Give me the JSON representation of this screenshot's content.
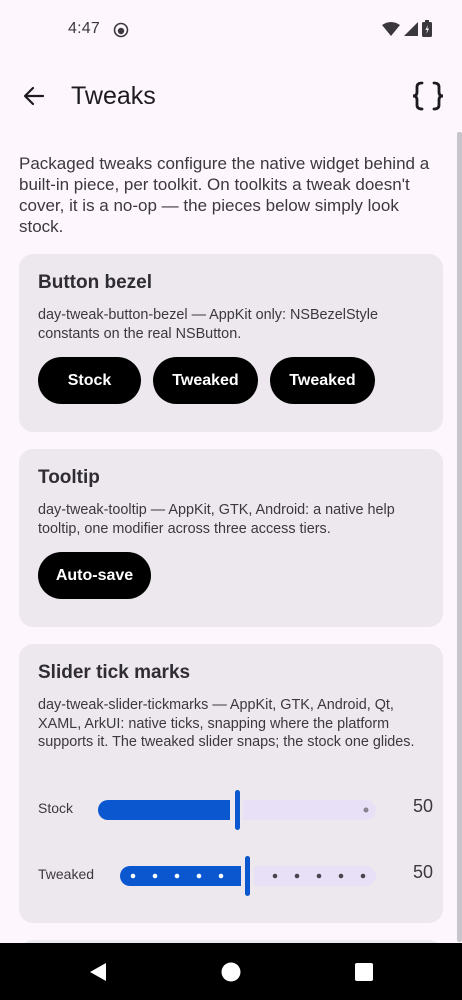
{
  "status_bar": {
    "time": "4:47"
  },
  "app_bar": {
    "title": "Tweaks"
  },
  "intro": "Packaged tweaks configure the native widget behind a built-in piece, per toolkit. On toolkits a tweak doesn't cover, it is a no-op — the pieces below simply look stock.",
  "cards": {
    "bezel": {
      "title": "Button bezel",
      "description": "day-tweak-button-bezel — AppKit only: NSBezelStyle constants on the real NSButton.",
      "buttons": [
        "Stock",
        "Tweaked",
        "Tweaked"
      ]
    },
    "tooltip": {
      "title": "Tooltip",
      "description": "day-tweak-tooltip — AppKit, GTK, Android: a native help tooltip, one modifier across three access tiers.",
      "button": "Auto-save"
    },
    "slider": {
      "title": "Slider tick marks",
      "description": "day-tweak-slider-tickmarks — AppKit, GTK, Android, Qt, XAML, ArkUI: native ticks, snapping where the platform supports it. The tweaked slider snaps; the stock one glides.",
      "stock": {
        "label": "Stock",
        "value": "50",
        "fraction": 0.5
      },
      "tweaked": {
        "label": "Tweaked",
        "value": "50",
        "fraction": 0.5
      }
    }
  },
  "colors": {
    "accent": "#0b57d0",
    "track_inactive": "#e8e0f6",
    "card": "#ece8ee"
  }
}
